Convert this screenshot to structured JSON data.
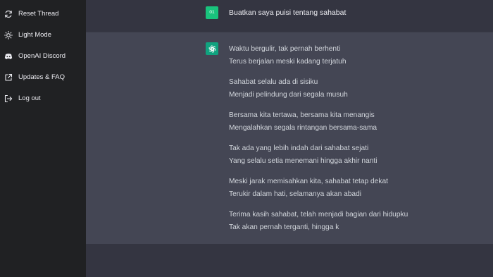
{
  "sidebar": {
    "items": [
      {
        "label": "Reset Thread",
        "icon": "refresh-icon"
      },
      {
        "label": "Light Mode",
        "icon": "sun-icon"
      },
      {
        "label": "OpenAI Discord",
        "icon": "discord-icon"
      },
      {
        "label": "Updates & FAQ",
        "icon": "external-link-icon"
      },
      {
        "label": "Log out",
        "icon": "logout-icon"
      }
    ]
  },
  "conversation": {
    "user": {
      "avatar_text": "01",
      "message": "Buatkan saya puisi tentang sahabat"
    },
    "assistant": {
      "stanzas": [
        [
          "Waktu bergulir, tak pernah berhenti",
          "Terus berjalan meski kadang terjatuh"
        ],
        [
          "Sahabat selalu ada di sisiku",
          "Menjadi pelindung dari segala musuh"
        ],
        [
          "Bersama kita tertawa, bersama kita menangis",
          "Mengalahkan segala rintangan bersama-sama"
        ],
        [
          "Tak ada yang lebih indah dari sahabat sejati",
          "Yang selalu setia menemani hingga akhir nanti"
        ],
        [
          "Meski jarak memisahkan kita, sahabat tetap dekat",
          "Terukir dalam hati, selamanya akan abadi"
        ],
        [
          "Terima kasih sahabat, telah menjadi bagian dari hidupku",
          "Tak akan pernah terganti, hingga k"
        ]
      ]
    }
  },
  "colors": {
    "sidebar_bg": "#202123",
    "main_bg": "#343541",
    "assistant_bg": "#444654",
    "user_avatar": "#19c37d",
    "assistant_avatar": "#10a37f"
  }
}
